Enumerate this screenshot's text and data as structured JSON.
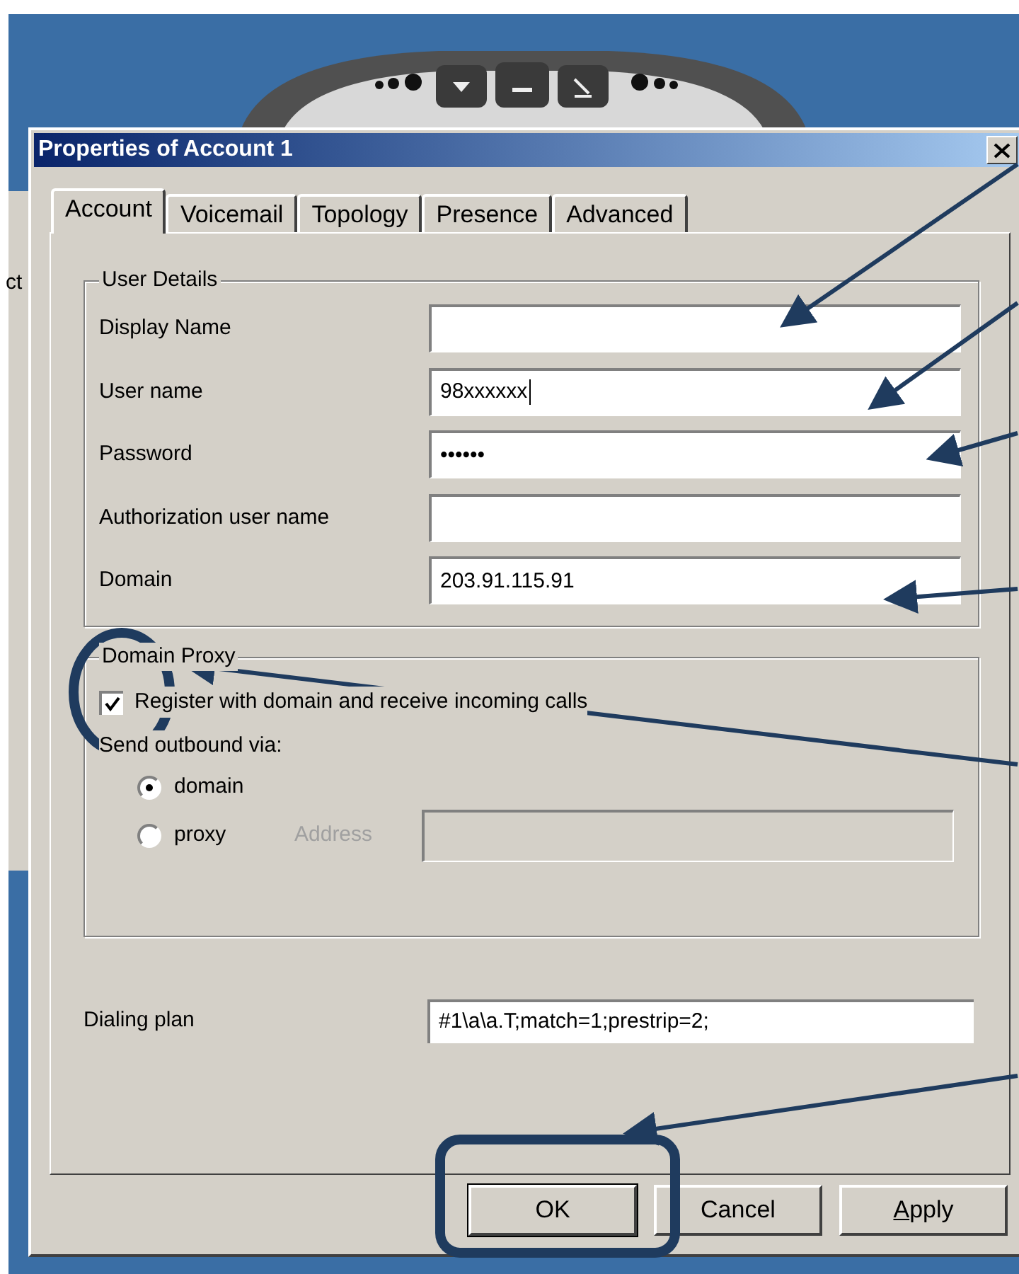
{
  "background_window": {
    "text": "ct"
  },
  "window": {
    "title": "Properties of Account 1"
  },
  "tabs": [
    {
      "label": "Account",
      "selected": true
    },
    {
      "label": "Voicemail",
      "selected": false
    },
    {
      "label": "Topology",
      "selected": false
    },
    {
      "label": "Presence",
      "selected": false
    },
    {
      "label": "Advanced",
      "selected": false
    }
  ],
  "user_details": {
    "title": "User Details",
    "fields": [
      {
        "label": "Display Name"
      },
      {
        "label": "User name",
        "value": "98xxxxxx",
        "focused": true
      },
      {
        "label": "Password",
        "value": "••••••"
      },
      {
        "label": "Authorization user name"
      },
      {
        "label": "Domain",
        "value": "203.91.115.91"
      }
    ]
  },
  "domain_proxy": {
    "title": "Domain Proxy",
    "register": {
      "label": "Register with domain and receive incoming calls",
      "checked": true
    },
    "send_label": "Send outbound via:",
    "options": [
      {
        "label": "domain",
        "selected": true
      },
      {
        "label": "proxy",
        "selected": false
      }
    ],
    "address": {
      "label": "Address",
      "disabled": true
    }
  },
  "dialing_plan": {
    "label": "Dialing plan",
    "value": "#1\\a\\a.T;match=1;prestrip=2;"
  },
  "buttons": [
    {
      "label": "OK",
      "default": true,
      "mnemonic": false
    },
    {
      "label": "Cancel",
      "default": false,
      "mnemonic": false
    },
    {
      "label": "Apply",
      "default": false,
      "mnemonic": true
    }
  ]
}
